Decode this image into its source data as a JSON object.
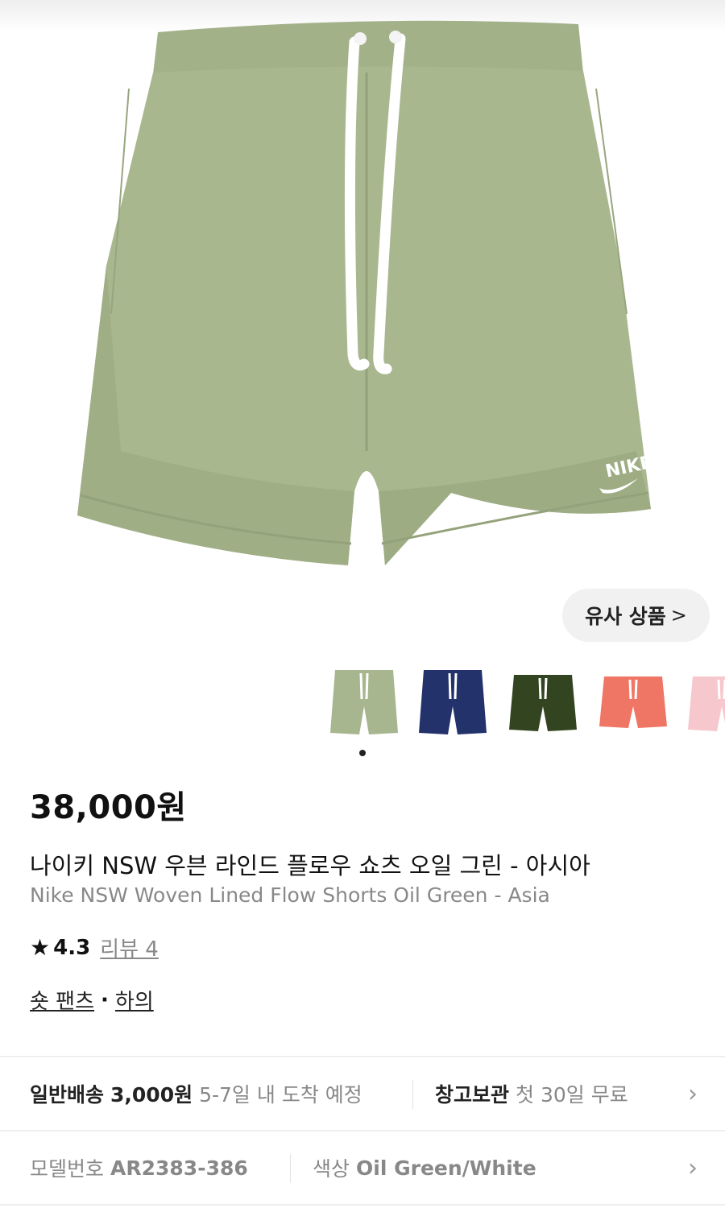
{
  "similar_button": {
    "label": "유사 상품",
    "chevron": ">"
  },
  "thumbnails": [
    {
      "color": "#a7b68f",
      "name": "oil-green"
    },
    {
      "color": "#24326b",
      "name": "navy"
    },
    {
      "color": "#334421",
      "name": "dark-green"
    },
    {
      "color": "#ef7565",
      "name": "coral"
    },
    {
      "color": "#f6c7cd",
      "name": "pink"
    }
  ],
  "product": {
    "price": "38,000원",
    "title_ko": "나이키 NSW 우븐 라인드 플로우 쇼츠 오일 그린 - 아시아",
    "title_en": "Nike NSW Woven Lined Flow Shorts Oil Green - Asia",
    "rating": "4.3",
    "review_text": "리뷰 4",
    "category_1": "숏 팬츠",
    "category_sep": "·",
    "category_2": "하의"
  },
  "shipping": {
    "label": "일반배송",
    "fee": "3,000원",
    "eta": "5-7일 내 도착 예정",
    "storage_label": "창고보관",
    "storage_note": "첫 30일 무료"
  },
  "specs": {
    "model_label": "모델번호",
    "model_value": "AR2383-386",
    "color_label": "색상",
    "color_value": "Oil Green/White"
  },
  "colors": {
    "shorts": "#a9b78f",
    "shorts_shadow": "#95a47c",
    "accent": "#111111"
  },
  "icons": {
    "star": "★",
    "chevron_right": "›"
  }
}
